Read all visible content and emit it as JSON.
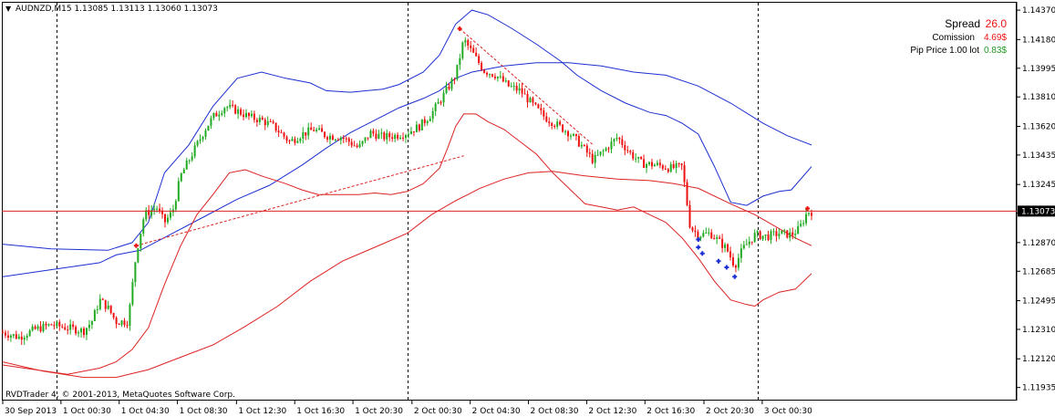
{
  "header": {
    "menu_glyph": "▼",
    "symbol_line": "AUDNZD,M15  1.13085 1.13113 1.13060 1.13073"
  },
  "info_panel": {
    "spread_label": "Spread",
    "spread_value": "26.0",
    "commission_label": "Comission",
    "commission_value": "4.69$",
    "pip_label": "Pip Price 1.00 lot",
    "pip_value": "0.83$"
  },
  "footer": {
    "copyright": "RVDTrader 4, © 2001-2013, MetaQuotes Software Corp."
  },
  "current_price": "1.13073",
  "colors": {
    "bull": "#22aa22",
    "bear": "#ee1111",
    "upper_band": "#1c2fd0",
    "lower_band": "#dd2222",
    "price_line": "#dd2222",
    "spread_value": "#ee1111",
    "pip_value": "#229922"
  },
  "chart_data": {
    "type": "candlestick",
    "symbol": "AUDNZD",
    "timeframe": "M15",
    "ylim": [
      1.1188,
      1.144
    ],
    "y_ticks": [
      "1.14370",
      "1.14180",
      "1.13995",
      "1.13810",
      "1.13620",
      "1.13435",
      "1.13245",
      "1.13060",
      "1.12870",
      "1.12685",
      "1.12495",
      "1.12310",
      "1.12120",
      "1.11935"
    ],
    "x_ticks": [
      "30 Sep 2013",
      "1 Oct 00:30",
      "1 Oct 04:30",
      "1 Oct 08:30",
      "1 Oct 12:30",
      "1 Oct 16:30",
      "1 Oct 20:30",
      "2 Oct 00:30",
      "2 Oct 04:30",
      "2 Oct 08:30",
      "2 Oct 12:30",
      "2 Oct 16:30",
      "2 Oct 20:30",
      "3 Oct 00:30"
    ],
    "x_tick_positions": [
      0,
      0.072,
      0.144,
      0.216,
      0.289,
      0.361,
      0.433,
      0.506,
      0.578,
      0.65,
      0.722,
      0.794,
      0.867,
      0.939
    ],
    "day_separators": [
      0.067,
      0.5,
      0.933
    ],
    "close_path": [
      [
        0.0,
        1.1229
      ],
      [
        0.02,
        1.1226
      ],
      [
        0.04,
        1.1231
      ],
      [
        0.06,
        1.1234
      ],
      [
        0.08,
        1.1232
      ],
      [
        0.1,
        1.123
      ],
      [
        0.11,
        1.1236
      ],
      [
        0.12,
        1.125
      ],
      [
        0.13,
        1.1245
      ],
      [
        0.14,
        1.1236
      ],
      [
        0.155,
        1.1236
      ],
      [
        0.165,
        1.128
      ],
      [
        0.175,
        1.1305
      ],
      [
        0.19,
        1.131
      ],
      [
        0.2,
        1.13
      ],
      [
        0.21,
        1.1307
      ],
      [
        0.22,
        1.133
      ],
      [
        0.235,
        1.1345
      ],
      [
        0.25,
        1.136
      ],
      [
        0.26,
        1.1368
      ],
      [
        0.275,
        1.1375
      ],
      [
        0.29,
        1.1372
      ],
      [
        0.305,
        1.1368
      ],
      [
        0.32,
        1.1366
      ],
      [
        0.335,
        1.1362
      ],
      [
        0.355,
        1.1352
      ],
      [
        0.37,
        1.1357
      ],
      [
        0.385,
        1.136
      ],
      [
        0.4,
        1.1356
      ],
      [
        0.42,
        1.1355
      ],
      [
        0.44,
        1.1348
      ],
      [
        0.455,
        1.1358
      ],
      [
        0.47,
        1.1355
      ],
      [
        0.485,
        1.1356
      ],
      [
        0.5,
        1.1358
      ],
      [
        0.515,
        1.1362
      ],
      [
        0.53,
        1.137
      ],
      [
        0.545,
        1.1382
      ],
      [
        0.56,
        1.1395
      ],
      [
        0.57,
        1.1418
      ],
      [
        0.58,
        1.141
      ],
      [
        0.595,
        1.1398
      ],
      [
        0.61,
        1.1395
      ],
      [
        0.625,
        1.1388
      ],
      [
        0.64,
        1.1385
      ],
      [
        0.655,
        1.1376
      ],
      [
        0.67,
        1.1368
      ],
      [
        0.685,
        1.1363
      ],
      [
        0.7,
        1.1358
      ],
      [
        0.715,
        1.135
      ],
      [
        0.73,
        1.134
      ],
      [
        0.745,
        1.1347
      ],
      [
        0.76,
        1.1355
      ],
      [
        0.775,
        1.1345
      ],
      [
        0.79,
        1.1338
      ],
      [
        0.81,
        1.1337
      ],
      [
        0.825,
        1.1335
      ],
      [
        0.84,
        1.1336
      ],
      [
        0.85,
        1.1297
      ],
      [
        0.86,
        1.1292
      ],
      [
        0.875,
        1.1293
      ],
      [
        0.885,
        1.1288
      ],
      [
        0.895,
        1.1283
      ],
      [
        0.905,
        1.1272
      ],
      [
        0.915,
        1.1283
      ],
      [
        0.93,
        1.1292
      ],
      [
        0.945,
        1.1291
      ],
      [
        0.96,
        1.1293
      ],
      [
        0.975,
        1.1292
      ],
      [
        0.985,
        1.1296
      ],
      [
        0.995,
        1.1307
      ],
      [
        1.0,
        1.1307
      ]
    ],
    "series": [
      {
        "name": "",
        "color": "#1c2fd0",
        "points": [
          [
            0.0,
            1.1286
          ],
          [
            0.06,
            1.1283
          ],
          [
            0.13,
            1.1282
          ],
          [
            0.16,
            1.1287
          ],
          [
            0.18,
            1.13
          ],
          [
            0.2,
            1.1332
          ],
          [
            0.23,
            1.135
          ],
          [
            0.26,
            1.1375
          ],
          [
            0.29,
            1.1393
          ],
          [
            0.32,
            1.1397
          ],
          [
            0.35,
            1.1393
          ],
          [
            0.38,
            1.139
          ],
          [
            0.4,
            1.1385
          ],
          [
            0.43,
            1.1384
          ],
          [
            0.45,
            1.1385
          ],
          [
            0.47,
            1.1386
          ],
          [
            0.49,
            1.1389
          ],
          [
            0.52,
            1.1397
          ],
          [
            0.54,
            1.1408
          ],
          [
            0.56,
            1.1428
          ],
          [
            0.58,
            1.1437
          ],
          [
            0.6,
            1.1434
          ],
          [
            0.63,
            1.1425
          ],
          [
            0.66,
            1.1415
          ],
          [
            0.69,
            1.1404
          ],
          [
            0.71,
            1.1395
          ],
          [
            0.74,
            1.1385
          ],
          [
            0.77,
            1.1377
          ],
          [
            0.8,
            1.1371
          ],
          [
            0.82,
            1.1369
          ],
          [
            0.84,
            1.1364
          ],
          [
            0.86,
            1.1357
          ],
          [
            0.88,
            1.1336
          ],
          [
            0.9,
            1.1313
          ],
          [
            0.92,
            1.1311
          ],
          [
            0.94,
            1.1317
          ],
          [
            0.96,
            1.132
          ],
          [
            0.975,
            1.1321
          ],
          [
            1.0,
            1.1336
          ]
        ]
      },
      {
        "name": "",
        "color": "#1c2fd0",
        "points": [
          [
            0.0,
            1.1265
          ],
          [
            0.04,
            1.1268
          ],
          [
            0.08,
            1.1271
          ],
          [
            0.12,
            1.1274
          ],
          [
            0.14,
            1.1279
          ],
          [
            0.17,
            1.1282
          ],
          [
            0.21,
            1.1293
          ],
          [
            0.25,
            1.1304
          ],
          [
            0.29,
            1.1315
          ],
          [
            0.33,
            1.1324
          ],
          [
            0.37,
            1.1337
          ],
          [
            0.4,
            1.1348
          ],
          [
            0.43,
            1.1358
          ],
          [
            0.46,
            1.1366
          ],
          [
            0.49,
            1.1374
          ],
          [
            0.52,
            1.138
          ],
          [
            0.54,
            1.1385
          ],
          [
            0.56,
            1.1393
          ],
          [
            0.58,
            1.1397
          ],
          [
            0.62,
            1.1401
          ],
          [
            0.66,
            1.1403
          ],
          [
            0.7,
            1.1403
          ],
          [
            0.74,
            1.1401
          ],
          [
            0.78,
            1.1397
          ],
          [
            0.82,
            1.1395
          ],
          [
            0.86,
            1.1388
          ],
          [
            0.9,
            1.1377
          ],
          [
            0.94,
            1.1364
          ],
          [
            0.97,
            1.1356
          ],
          [
            1.0,
            1.135
          ]
        ]
      },
      {
        "name": "",
        "color": "#dd2222",
        "points": [
          [
            0.0,
            1.121
          ],
          [
            0.05,
            1.1204
          ],
          [
            0.1,
            1.12
          ],
          [
            0.14,
            1.12
          ],
          [
            0.18,
            1.1205
          ],
          [
            0.22,
            1.1213
          ],
          [
            0.26,
            1.1221
          ],
          [
            0.3,
            1.1233
          ],
          [
            0.34,
            1.1246
          ],
          [
            0.38,
            1.1262
          ],
          [
            0.42,
            1.1275
          ],
          [
            0.46,
            1.1284
          ],
          [
            0.5,
            1.1293
          ],
          [
            0.53,
            1.1305
          ],
          [
            0.56,
            1.1314
          ],
          [
            0.59,
            1.1322
          ],
          [
            0.62,
            1.1328
          ],
          [
            0.65,
            1.1332
          ],
          [
            0.68,
            1.1333
          ],
          [
            0.72,
            1.133
          ],
          [
            0.76,
            1.1328
          ],
          [
            0.8,
            1.1327
          ],
          [
            0.83,
            1.1325
          ],
          [
            0.86,
            1.1322
          ],
          [
            0.9,
            1.1312
          ],
          [
            0.93,
            1.1305
          ],
          [
            0.96,
            1.1296
          ],
          [
            0.98,
            1.129
          ],
          [
            1.0,
            1.1285
          ]
        ]
      },
      {
        "name": "",
        "color": "#dd2222",
        "points": [
          [
            0.0,
            1.1208
          ],
          [
            0.04,
            1.1205
          ],
          [
            0.08,
            1.1202
          ],
          [
            0.12,
            1.1206
          ],
          [
            0.14,
            1.121
          ],
          [
            0.16,
            1.1218
          ],
          [
            0.18,
            1.1232
          ],
          [
            0.2,
            1.126
          ],
          [
            0.22,
            1.1285
          ],
          [
            0.24,
            1.1305
          ],
          [
            0.26,
            1.1318
          ],
          [
            0.28,
            1.1332
          ],
          [
            0.3,
            1.1334
          ],
          [
            0.32,
            1.133
          ],
          [
            0.35,
            1.1325
          ],
          [
            0.37,
            1.1321
          ],
          [
            0.39,
            1.1318
          ],
          [
            0.42,
            1.1318
          ],
          [
            0.44,
            1.1318
          ],
          [
            0.46,
            1.1319
          ],
          [
            0.48,
            1.1318
          ],
          [
            0.5,
            1.132
          ],
          [
            0.52,
            1.1325
          ],
          [
            0.54,
            1.1335
          ],
          [
            0.55,
            1.1348
          ],
          [
            0.56,
            1.1362
          ],
          [
            0.57,
            1.137
          ],
          [
            0.585,
            1.137
          ],
          [
            0.6,
            1.1365
          ],
          [
            0.62,
            1.136
          ],
          [
            0.64,
            1.1352
          ],
          [
            0.66,
            1.1344
          ],
          [
            0.68,
            1.1332
          ],
          [
            0.7,
            1.1322
          ],
          [
            0.72,
            1.1312
          ],
          [
            0.74,
            1.131
          ],
          [
            0.76,
            1.1308
          ],
          [
            0.78,
            1.131
          ],
          [
            0.8,
            1.1305
          ],
          [
            0.82,
            1.13
          ],
          [
            0.84,
            1.129
          ],
          [
            0.86,
            1.1277
          ],
          [
            0.88,
            1.1262
          ],
          [
            0.9,
            1.125
          ],
          [
            0.92,
            1.1247
          ],
          [
            0.93,
            1.1246
          ],
          [
            0.94,
            1.125
          ],
          [
            0.96,
            1.1255
          ],
          [
            0.98,
            1.1257
          ],
          [
            1.0,
            1.1267
          ]
        ]
      }
    ],
    "dotted_lines": [
      [
        [
          0.165,
          1.1285
        ],
        [
          0.57,
          1.1343
        ]
      ],
      [
        [
          0.565,
          1.1425
        ],
        [
          0.73,
          1.135
        ]
      ]
    ],
    "markers": [
      {
        "x": 0.165,
        "y": 1.1285,
        "color": "#ee1111"
      },
      {
        "x": 0.565,
        "y": 1.1425,
        "color": "#ee1111"
      },
      {
        "x": 0.86,
        "y": 1.1289,
        "color": "#1c2fd0"
      },
      {
        "x": 0.86,
        "y": 1.1284,
        "color": "#1c2fd0"
      },
      {
        "x": 0.865,
        "y": 1.128,
        "color": "#1c2fd0"
      },
      {
        "x": 0.885,
        "y": 1.1275,
        "color": "#1c2fd0"
      },
      {
        "x": 0.895,
        "y": 1.1271,
        "color": "#1c2fd0"
      },
      {
        "x": 0.905,
        "y": 1.1265,
        "color": "#1c2fd0"
      },
      {
        "x": 0.995,
        "y": 1.1309,
        "color": "#ee1111"
      }
    ]
  }
}
